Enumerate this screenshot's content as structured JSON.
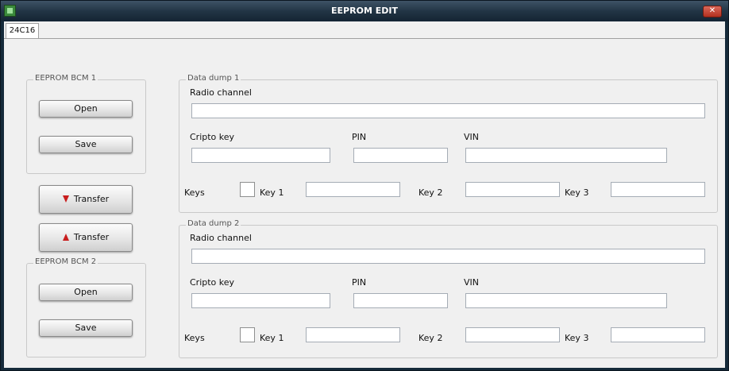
{
  "window": {
    "title": "EEPROM EDIT",
    "close_glyph": "✕"
  },
  "tabs": [
    {
      "label": "24C16"
    }
  ],
  "bcm1": {
    "legend": "EEPROM BCM 1",
    "open_label": "Open",
    "save_label": "Save"
  },
  "bcm2": {
    "legend": "EEPROM BCM 2",
    "open_label": "Open",
    "save_label": "Save"
  },
  "transfer_down": {
    "label": "Transfer"
  },
  "transfer_up": {
    "label": "Transfer"
  },
  "dump1": {
    "legend": "Data dump 1",
    "radio_label": "Radio channel",
    "radio_value": "",
    "cripto_label": "Cripto key",
    "cripto_value": "",
    "pin_label": "PIN",
    "pin_value": "",
    "vin_label": "VIN",
    "vin_value": "",
    "keys_label": "Keys",
    "keys_checked": false,
    "key1_label": "Key 1",
    "key1_value": "",
    "key2_label": "Key 2",
    "key2_value": "",
    "key3_label": "Key 3",
    "key3_value": ""
  },
  "dump2": {
    "legend": "Data dump 2",
    "radio_label": "Radio channel",
    "radio_value": "",
    "cripto_label": "Cripto key",
    "cripto_value": "",
    "pin_label": "PIN",
    "pin_value": "",
    "vin_label": "VIN",
    "vin_value": "",
    "keys_label": "Keys",
    "keys_checked": false,
    "key1_label": "Key 1",
    "key1_value": "",
    "key2_label": "Key 2",
    "key2_value": "",
    "key3_label": "Key 3",
    "key3_value": ""
  },
  "colors": {
    "titlebar": "#223545",
    "panel": "#f0f0f0",
    "arrow": "#c81d1d",
    "close": "#b2301f"
  }
}
